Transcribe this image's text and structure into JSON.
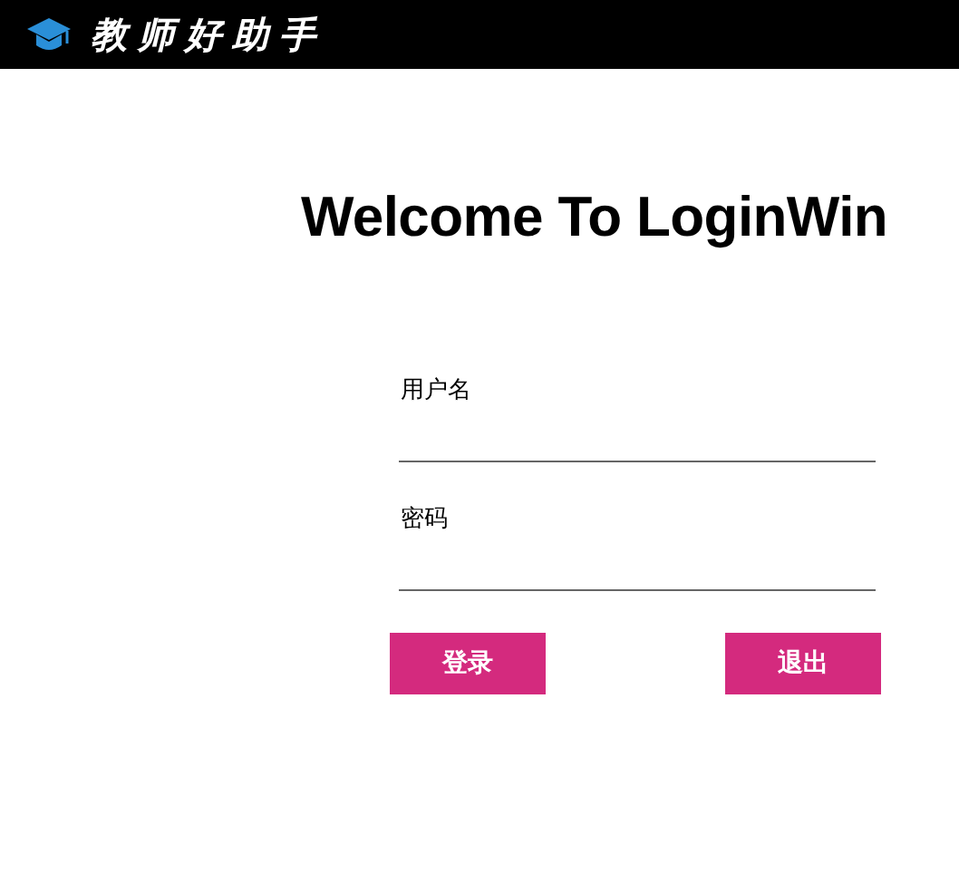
{
  "window": {
    "title": "教师好助手"
  },
  "heading": "Welcome To LoginWin",
  "fields": [
    {
      "label": "用户名"
    },
    {
      "label": "密码"
    }
  ],
  "buttons": [
    "登录",
    "退出"
  ]
}
